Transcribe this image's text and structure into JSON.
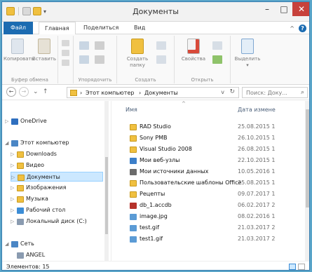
{
  "titlebar": {
    "title": "Документы",
    "min_glyph": "–",
    "max_glyph": "□",
    "close_glyph": "✕",
    "qa_caret": "▾"
  },
  "tabs": {
    "file": "Файл",
    "home": "Главная",
    "share": "Поделиться",
    "view": "Вид",
    "collapse_glyph": "^",
    "help_glyph": "?"
  },
  "ribbon": {
    "copy": "Копировать",
    "paste": "Вставить",
    "clipboard_group": "Буфер обмена",
    "organize_group": "Упорядочить",
    "new_folder_line1": "Создать",
    "new_folder_line2": "папку",
    "create_group": "Создать",
    "properties": "Свойства",
    "open_group": "Открыть",
    "select": "Выделить",
    "select_caret": "▾"
  },
  "address": {
    "back": "←",
    "forward": "→",
    "dropdown": "⌄",
    "up": "↑",
    "crumb_sep1": "›",
    "crumb1": "Этот компьютер",
    "crumb_sep2": "›",
    "crumb2": "Документы",
    "dropdown_caret": "v",
    "refresh": "↻",
    "search_placeholder": "Поиск: Доку...",
    "search_glyph": "⌕"
  },
  "navpane": {
    "items": [
      {
        "label": "OneDrive",
        "tri": "▷",
        "icon_color": "#2f6fbf"
      },
      {
        "label": "Этот компьютер",
        "tri": "◢",
        "icon_color": "#4a86c5"
      },
      {
        "label": "Downloads",
        "tri": "▷",
        "icon_color": "#f0c040"
      },
      {
        "label": "Видео",
        "tri": "▷",
        "icon_color": "#f0c040"
      },
      {
        "label": "Документы",
        "tri": "▷",
        "icon_color": "#f0c040"
      },
      {
        "label": "Изображения",
        "tri": "▷",
        "icon_color": "#f0c040"
      },
      {
        "label": "Музыка",
        "tri": "▷",
        "icon_color": "#f0c040"
      },
      {
        "label": "Рабочий стол",
        "tri": "▷",
        "icon_color": "#3c8dd6"
      },
      {
        "label": "Локальный диск (C:)",
        "tri": "▷",
        "icon_color": "#8a9bb0"
      },
      {
        "label": "Сеть",
        "tri": "◢",
        "icon_color": "#4a86c5"
      },
      {
        "label": "ANGEL",
        "tri": "",
        "icon_color": "#8a9bb0"
      }
    ]
  },
  "content": {
    "col_name": "Имя",
    "col_date": "Дата измене",
    "sort_glyph": "^",
    "files": [
      {
        "name": "RAD Studio",
        "date": "25.08.2015 1",
        "icon_color": "#f0c040"
      },
      {
        "name": "Sony PMB",
        "date": "26.10.2015 1",
        "icon_color": "#f0c040"
      },
      {
        "name": "Visual Studio 2008",
        "date": "26.08.2015 1",
        "icon_color": "#f0c040"
      },
      {
        "name": "Мои веб-узлы",
        "date": "22.10.2015 1",
        "icon_color": "#3c7fc9"
      },
      {
        "name": "Мои источники данных",
        "date": "10.05.2016 1",
        "icon_color": "#6b6b6b"
      },
      {
        "name": "Пользовательские шаблоны Office",
        "date": "25.08.2015 1",
        "icon_color": "#f0c040"
      },
      {
        "name": "Рецепты",
        "date": "09.07.2017 1",
        "icon_color": "#f0c040"
      },
      {
        "name": "db_1.accdb",
        "date": "06.02.2017 2",
        "icon_color": "#b5322b"
      },
      {
        "name": "image.jpg",
        "date": "08.02.2016 1",
        "icon_color": "#5b9bd5"
      },
      {
        "name": "test.gif",
        "date": "21.03.2017 2",
        "icon_color": "#5b9bd5"
      },
      {
        "name": "test1.gif",
        "date": "21.03.2017 2",
        "icon_color": "#5b9bd5"
      }
    ]
  },
  "status": {
    "count": "Элементов: 15"
  }
}
